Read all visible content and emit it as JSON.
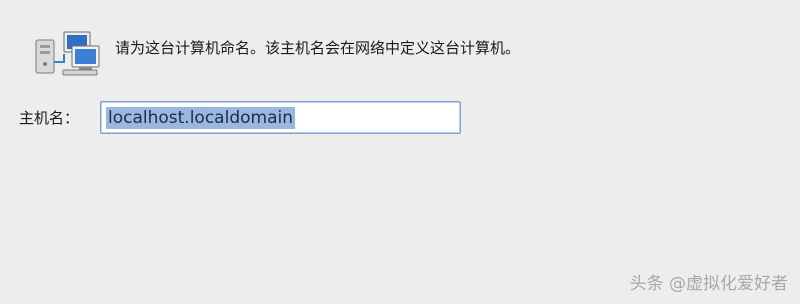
{
  "icon": "network-computers-icon",
  "description": "请为这台计算机命名。该主机名会在网络中定义这台计算机。",
  "hostname": {
    "label": "主机名：",
    "value": "localhost.localdomain"
  },
  "watermark": "头条 @虚拟化爱好者",
  "colors": {
    "background": "#ededed",
    "selection": "#9ab8de",
    "field_border": "#7aa3d4"
  }
}
